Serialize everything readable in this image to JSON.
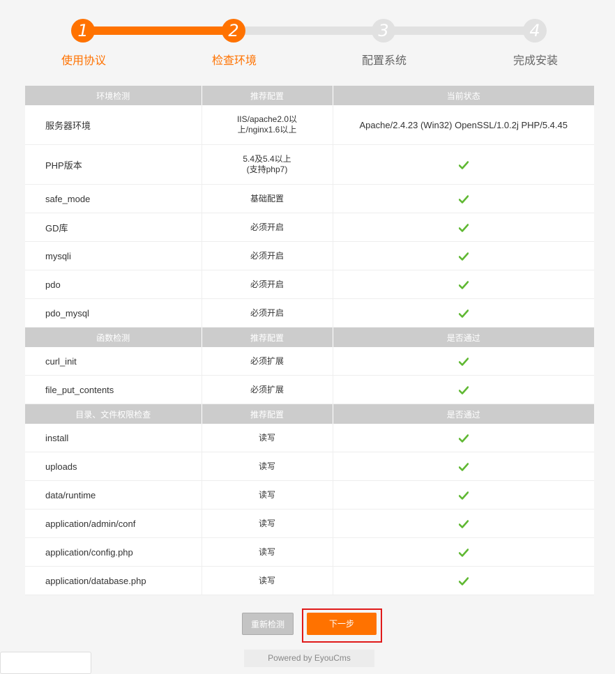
{
  "steps": [
    {
      "num": "1",
      "label": "使用协议",
      "state": "done"
    },
    {
      "num": "2",
      "label": "检查环境",
      "state": "active"
    },
    {
      "num": "3",
      "label": "配置系统",
      "state": "pending"
    },
    {
      "num": "4",
      "label": "完成安装",
      "state": "pending"
    }
  ],
  "sections": [
    {
      "headers": [
        "环境检测",
        "推荐配置",
        "当前状态"
      ],
      "rows": [
        {
          "name": "服务器环境",
          "recommend": "IIS/apache2.0以上/nginx1.6以上",
          "status": "Apache/2.4.23 (Win32) OpenSSL/1.0.2j PHP/5.4.45"
        },
        {
          "name": "PHP版本",
          "recommend": "5.4及5.4以上(支持php7)",
          "status": "check"
        },
        {
          "name": "safe_mode",
          "recommend": "基础配置",
          "status": "check"
        },
        {
          "name": "GD库",
          "recommend": "必须开启",
          "status": "check"
        },
        {
          "name": "mysqli",
          "recommend": "必须开启",
          "status": "check"
        },
        {
          "name": "pdo",
          "recommend": "必须开启",
          "status": "check"
        },
        {
          "name": "pdo_mysql",
          "recommend": "必须开启",
          "status": "check"
        }
      ]
    },
    {
      "headers": [
        "函数检测",
        "推荐配置",
        "是否通过"
      ],
      "rows": [
        {
          "name": "curl_init",
          "recommend": "必须扩展",
          "status": "check"
        },
        {
          "name": "file_put_contents",
          "recommend": "必须扩展",
          "status": "check"
        }
      ]
    },
    {
      "headers": [
        "目录、文件权限检查",
        "推荐配置",
        "是否通过"
      ],
      "rows": [
        {
          "name": "install",
          "recommend": "读写",
          "status": "check"
        },
        {
          "name": "uploads",
          "recommend": "读写",
          "status": "check"
        },
        {
          "name": "data/runtime",
          "recommend": "读写",
          "status": "check"
        },
        {
          "name": "application/admin/conf",
          "recommend": "读写",
          "status": "check"
        },
        {
          "name": "application/config.php",
          "recommend": "读写",
          "status": "check"
        },
        {
          "name": "application/database.php",
          "recommend": "读写",
          "status": "check"
        }
      ]
    }
  ],
  "php_recommend_lines": [
    "5.4及5.4以上",
    "(支持php7)"
  ],
  "server_recommend_lines": [
    "IIS/apache2.0以",
    "上/nginx1.6以上"
  ],
  "buttons": {
    "recheck": "重新检测",
    "next": "下一步"
  },
  "footer": "Powered by EyouCms",
  "colors": {
    "accent": "#ff7200",
    "pending": "#e1e1e1",
    "header_bg": "#cccccc",
    "check": "#5fb832",
    "highlight": "#e01a1a"
  }
}
